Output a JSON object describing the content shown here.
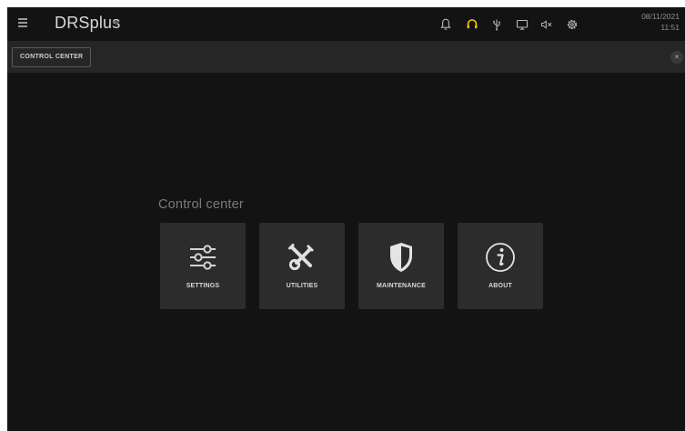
{
  "app": {
    "title": "DRSplus"
  },
  "header": {
    "date": "08/11/2021",
    "time": "11:51",
    "icons": [
      "bell-icon",
      "headset-icon",
      "usb-icon",
      "monitor-icon",
      "speaker-muted-icon",
      "gear-icon"
    ],
    "accent_color": "#f5c400"
  },
  "subbar": {
    "button_label": "CONTROL CENTER",
    "close_symbol": "×"
  },
  "main": {
    "section_title": "Control center",
    "tiles": [
      {
        "label": "SETTINGS",
        "icon": "sliders-icon"
      },
      {
        "label": "UTILITIES",
        "icon": "tools-icon"
      },
      {
        "label": "MAINTENANCE",
        "icon": "shield-icon"
      },
      {
        "label": "ABOUT",
        "icon": "info-icon"
      }
    ]
  }
}
